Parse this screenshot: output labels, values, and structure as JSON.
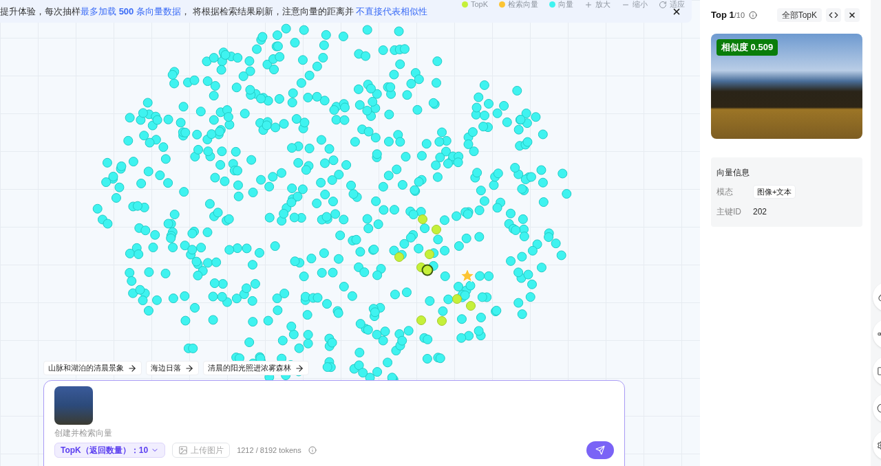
{
  "banner": {
    "segments": [
      {
        "text": "提升体验，每次抽样",
        "kind": "plain"
      },
      {
        "text": "最多加载 **500** 条向量数据",
        "kind": "highlight"
      },
      {
        "text": "， 将根据检索结果刷新，注意向量的距离并 ",
        "kind": "plain"
      },
      {
        "text": "不直接代表相似性",
        "kind": "highlight"
      }
    ]
  },
  "legend": [
    {
      "label": "TopK",
      "color": "#c5f03a"
    },
    {
      "label": "检索向量",
      "color": "#fcc433"
    },
    {
      "label": "向量",
      "color": "#3ff3f0"
    }
  ],
  "zoom_controls": [
    {
      "label": "放大",
      "kind": "zoom-in"
    },
    {
      "label": "缩小",
      "kind": "zoom-out"
    },
    {
      "label": "适应",
      "kind": "fit"
    }
  ],
  "suggestions": [
    "山脉和湖泊的清晨景象",
    "海边日落",
    "清晨的阳光照进浓雾森林"
  ],
  "search_box": {
    "placeholder": "创建并检索向量",
    "topk": "TopK（返回数量）：10",
    "upload": "上传图片",
    "tokens": "1212 / 8192 tokens"
  },
  "result_panel": {
    "rank": "Top 1",
    "total": "/10",
    "all_topk": "全部TopK",
    "similarity": "相似度 0.509",
    "info_title": "向量信息",
    "fields": [
      {
        "label": "模态",
        "value": "图像+文本",
        "kind": "tag"
      },
      {
        "label": "主键ID",
        "value": "202",
        "kind": "plain"
      }
    ]
  }
}
